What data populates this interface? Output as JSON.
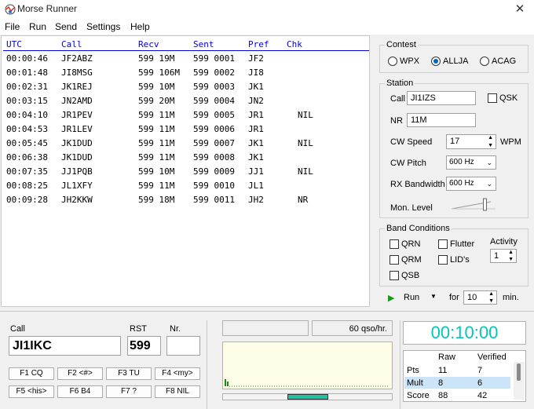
{
  "window": {
    "title": "Morse Runner"
  },
  "menu": [
    "File",
    "Run",
    "Send",
    "Settings",
    "Help"
  ],
  "log": {
    "headers": [
      "UTC",
      "Call",
      "Recv",
      "Sent",
      "Pref",
      "Chk"
    ],
    "rows": [
      [
        "00:00:46",
        "JF2ABZ",
        "599 19M",
        "599 0001",
        "JF2",
        ""
      ],
      [
        "00:01:48",
        "JI8MSG",
        "599 106M",
        "599 0002",
        "JI8",
        ""
      ],
      [
        "00:02:31",
        "JK1REJ",
        "599 10M",
        "599 0003",
        "JK1",
        ""
      ],
      [
        "00:03:15",
        "JN2AMD",
        "599 20M",
        "599 0004",
        "JN2",
        ""
      ],
      [
        "00:04:10",
        "JR1PEV",
        "599 11M",
        "599 0005",
        "JR1",
        "NIL"
      ],
      [
        "00:04:53",
        "JR1LEV",
        "599 11M",
        "599 0006",
        "JR1",
        ""
      ],
      [
        "00:05:45",
        "JK1DUD",
        "599 11M",
        "599 0007",
        "JK1",
        "NIL"
      ],
      [
        "00:06:38",
        "JK1DUD",
        "599 11M",
        "599 0008",
        "JK1",
        ""
      ],
      [
        "00:07:35",
        "JJ1PQB",
        "599 10M",
        "599 0009",
        "JJ1",
        "NIL"
      ],
      [
        "00:08:25",
        "JL1XFY",
        "599 11M",
        "599 0010",
        "JL1",
        ""
      ],
      [
        "00:09:28",
        "JH2KKW",
        "599 18M",
        "599 0011",
        "JH2",
        "NR"
      ]
    ]
  },
  "contest": {
    "title": "Contest",
    "options": [
      "WPX",
      "ALLJA",
      "ACAG"
    ],
    "selected": "ALLJA"
  },
  "station": {
    "title": "Station",
    "call_label": "Call",
    "call_value": "JI1IZS",
    "qsk_label": "QSK",
    "nr_label": "NR",
    "nr_value": "11M",
    "cw_speed_label": "CW Speed",
    "cw_speed_value": "17",
    "wpm_label": "WPM",
    "cw_pitch_label": "CW Pitch",
    "cw_pitch_value": "600 Hz",
    "rx_bw_label": "RX Bandwidth",
    "rx_bw_value": "600 Hz",
    "mon_level_label": "Mon. Level",
    "mon_level": 0.85
  },
  "band": {
    "title": "Band Conditions",
    "qrn": "QRN",
    "qrm": "QRM",
    "qsb": "QSB",
    "flutter": "Flutter",
    "lids": "LID's",
    "activity_label": "Activity",
    "activity_value": "1"
  },
  "run": {
    "run_label": "Run",
    "for_label": "for",
    "minutes_value": "10",
    "min_label": "min."
  },
  "entry": {
    "call_label": "Call",
    "call_value": "JI1IKC",
    "rst_label": "RST",
    "rst_value": "599",
    "nr_label": "Nr.",
    "nr_value": ""
  },
  "fkeys": [
    "F1 CQ",
    "F2 <#>",
    "F3 TU",
    "F4 <my>",
    "F5 <his>",
    "F6 B4",
    "F7 ?",
    "F8 NIL"
  ],
  "rate": {
    "text": "60 qso/hr."
  },
  "timer": {
    "value": "00:10:00",
    "color": "#00c8b4"
  },
  "score": {
    "headers": [
      "",
      "Raw",
      "Verified"
    ],
    "rows": [
      [
        "Pts",
        "11",
        "7"
      ],
      [
        "Mult",
        "8",
        "6"
      ],
      [
        "Score",
        "88",
        "42"
      ]
    ]
  }
}
